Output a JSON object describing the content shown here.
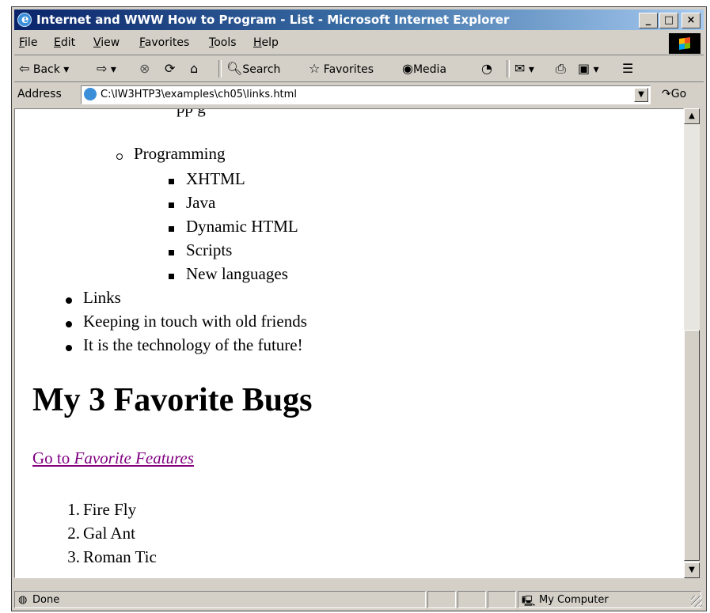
{
  "window": {
    "title": "Internet and WWW How to Program - List - Microsoft Internet Explorer",
    "min_label": "_",
    "max_label": "□",
    "close_label": "×"
  },
  "menu": [
    "File",
    "Edit",
    "View",
    "Favorites",
    "Tools",
    "Help"
  ],
  "toolbar": {
    "back": "Back",
    "search": "Search",
    "favorites": "Favorites",
    "media": "Media"
  },
  "address": {
    "label": "Address",
    "value": "C:\\IW3HTP3\\examples\\ch05\\links.html",
    "go": "Go"
  },
  "content": {
    "programming": "Programming",
    "programming_items": [
      "XHTML",
      "Java",
      "Dynamic HTML",
      "Scripts",
      "New languages"
    ],
    "top_items": [
      "Links",
      "Keeping in touch with old friends",
      "It is the technology of the future!"
    ],
    "heading": "My 3 Favorite Bugs",
    "link_prefix": "Go to ",
    "link_emphasis": "Favorite Features",
    "bugs": [
      "Fire Fly",
      "Gal Ant",
      "Roman Tic"
    ],
    "bug_numbers": [
      "1.",
      "2.",
      "3."
    ]
  },
  "status": {
    "text": "Done",
    "zone": "My Computer"
  },
  "icons": [
    "ie-logo-icon",
    "back-arrow-icon",
    "forward-arrow-icon",
    "stop-icon",
    "refresh-icon",
    "home-icon",
    "search-icon",
    "favorites-icon",
    "media-icon",
    "history-icon",
    "mail-icon",
    "print-icon",
    "edit-icon",
    "discuss-icon",
    "go-arrow-icon",
    "computer-icon"
  ]
}
